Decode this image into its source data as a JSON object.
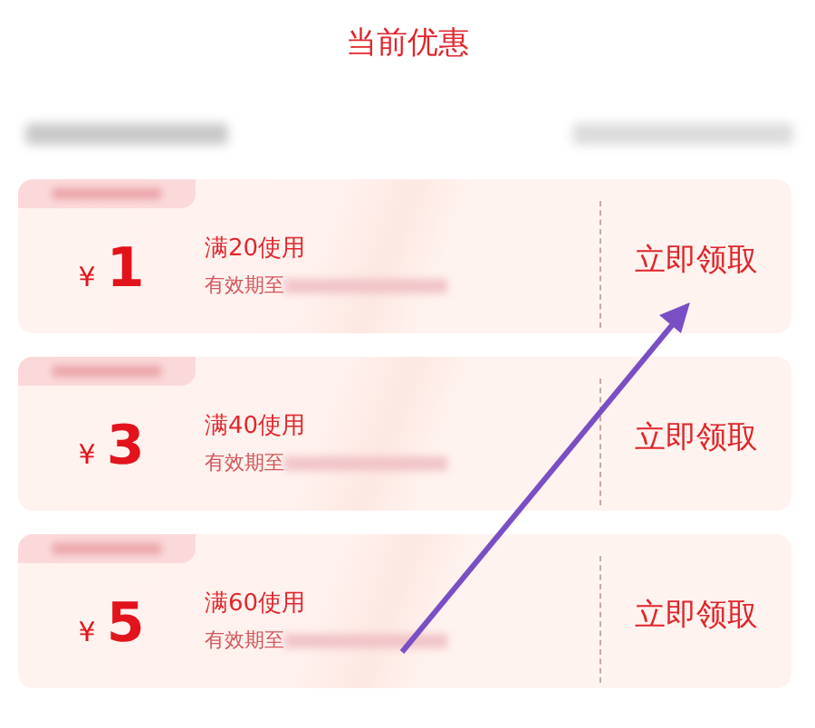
{
  "title": "当前优惠",
  "coupons": [
    {
      "currency": "¥",
      "amount": "1",
      "condition": "满20使用",
      "validity_label": "有效期至",
      "button": "立即领取"
    },
    {
      "currency": "¥",
      "amount": "3",
      "condition": "满40使用",
      "validity_label": "有效期至",
      "button": "立即领取"
    },
    {
      "currency": "¥",
      "amount": "5",
      "condition": "满60使用",
      "validity_label": "有效期至",
      "button": "立即领取"
    }
  ]
}
